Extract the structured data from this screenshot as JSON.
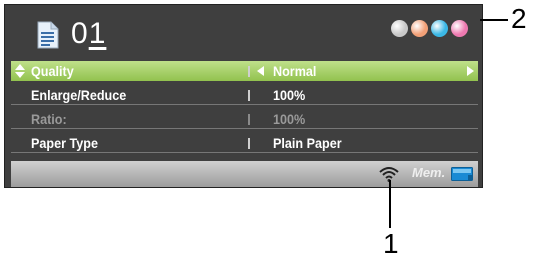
{
  "header": {
    "copy_count": "0",
    "copy_cursor": "1",
    "ink_colors": [
      "#c8c8c8",
      "#f2a077",
      "#3bb8e6",
      "#ee79b0"
    ]
  },
  "settings": [
    {
      "label": "Quality",
      "value": "Normal"
    },
    {
      "label": "Enlarge/Reduce",
      "value": "100%"
    },
    {
      "label": "Ratio:",
      "value": "100%"
    },
    {
      "label": "Paper Type",
      "value": "Plain Paper"
    }
  ],
  "status_bar": {
    "memory_label": "Mem."
  },
  "callouts": {
    "one": "1",
    "two": "2"
  },
  "colors": {
    "lcd_background": "#3f3f3f",
    "selected_row": "#a6cf65",
    "status_bar": "#b4b4b4"
  }
}
